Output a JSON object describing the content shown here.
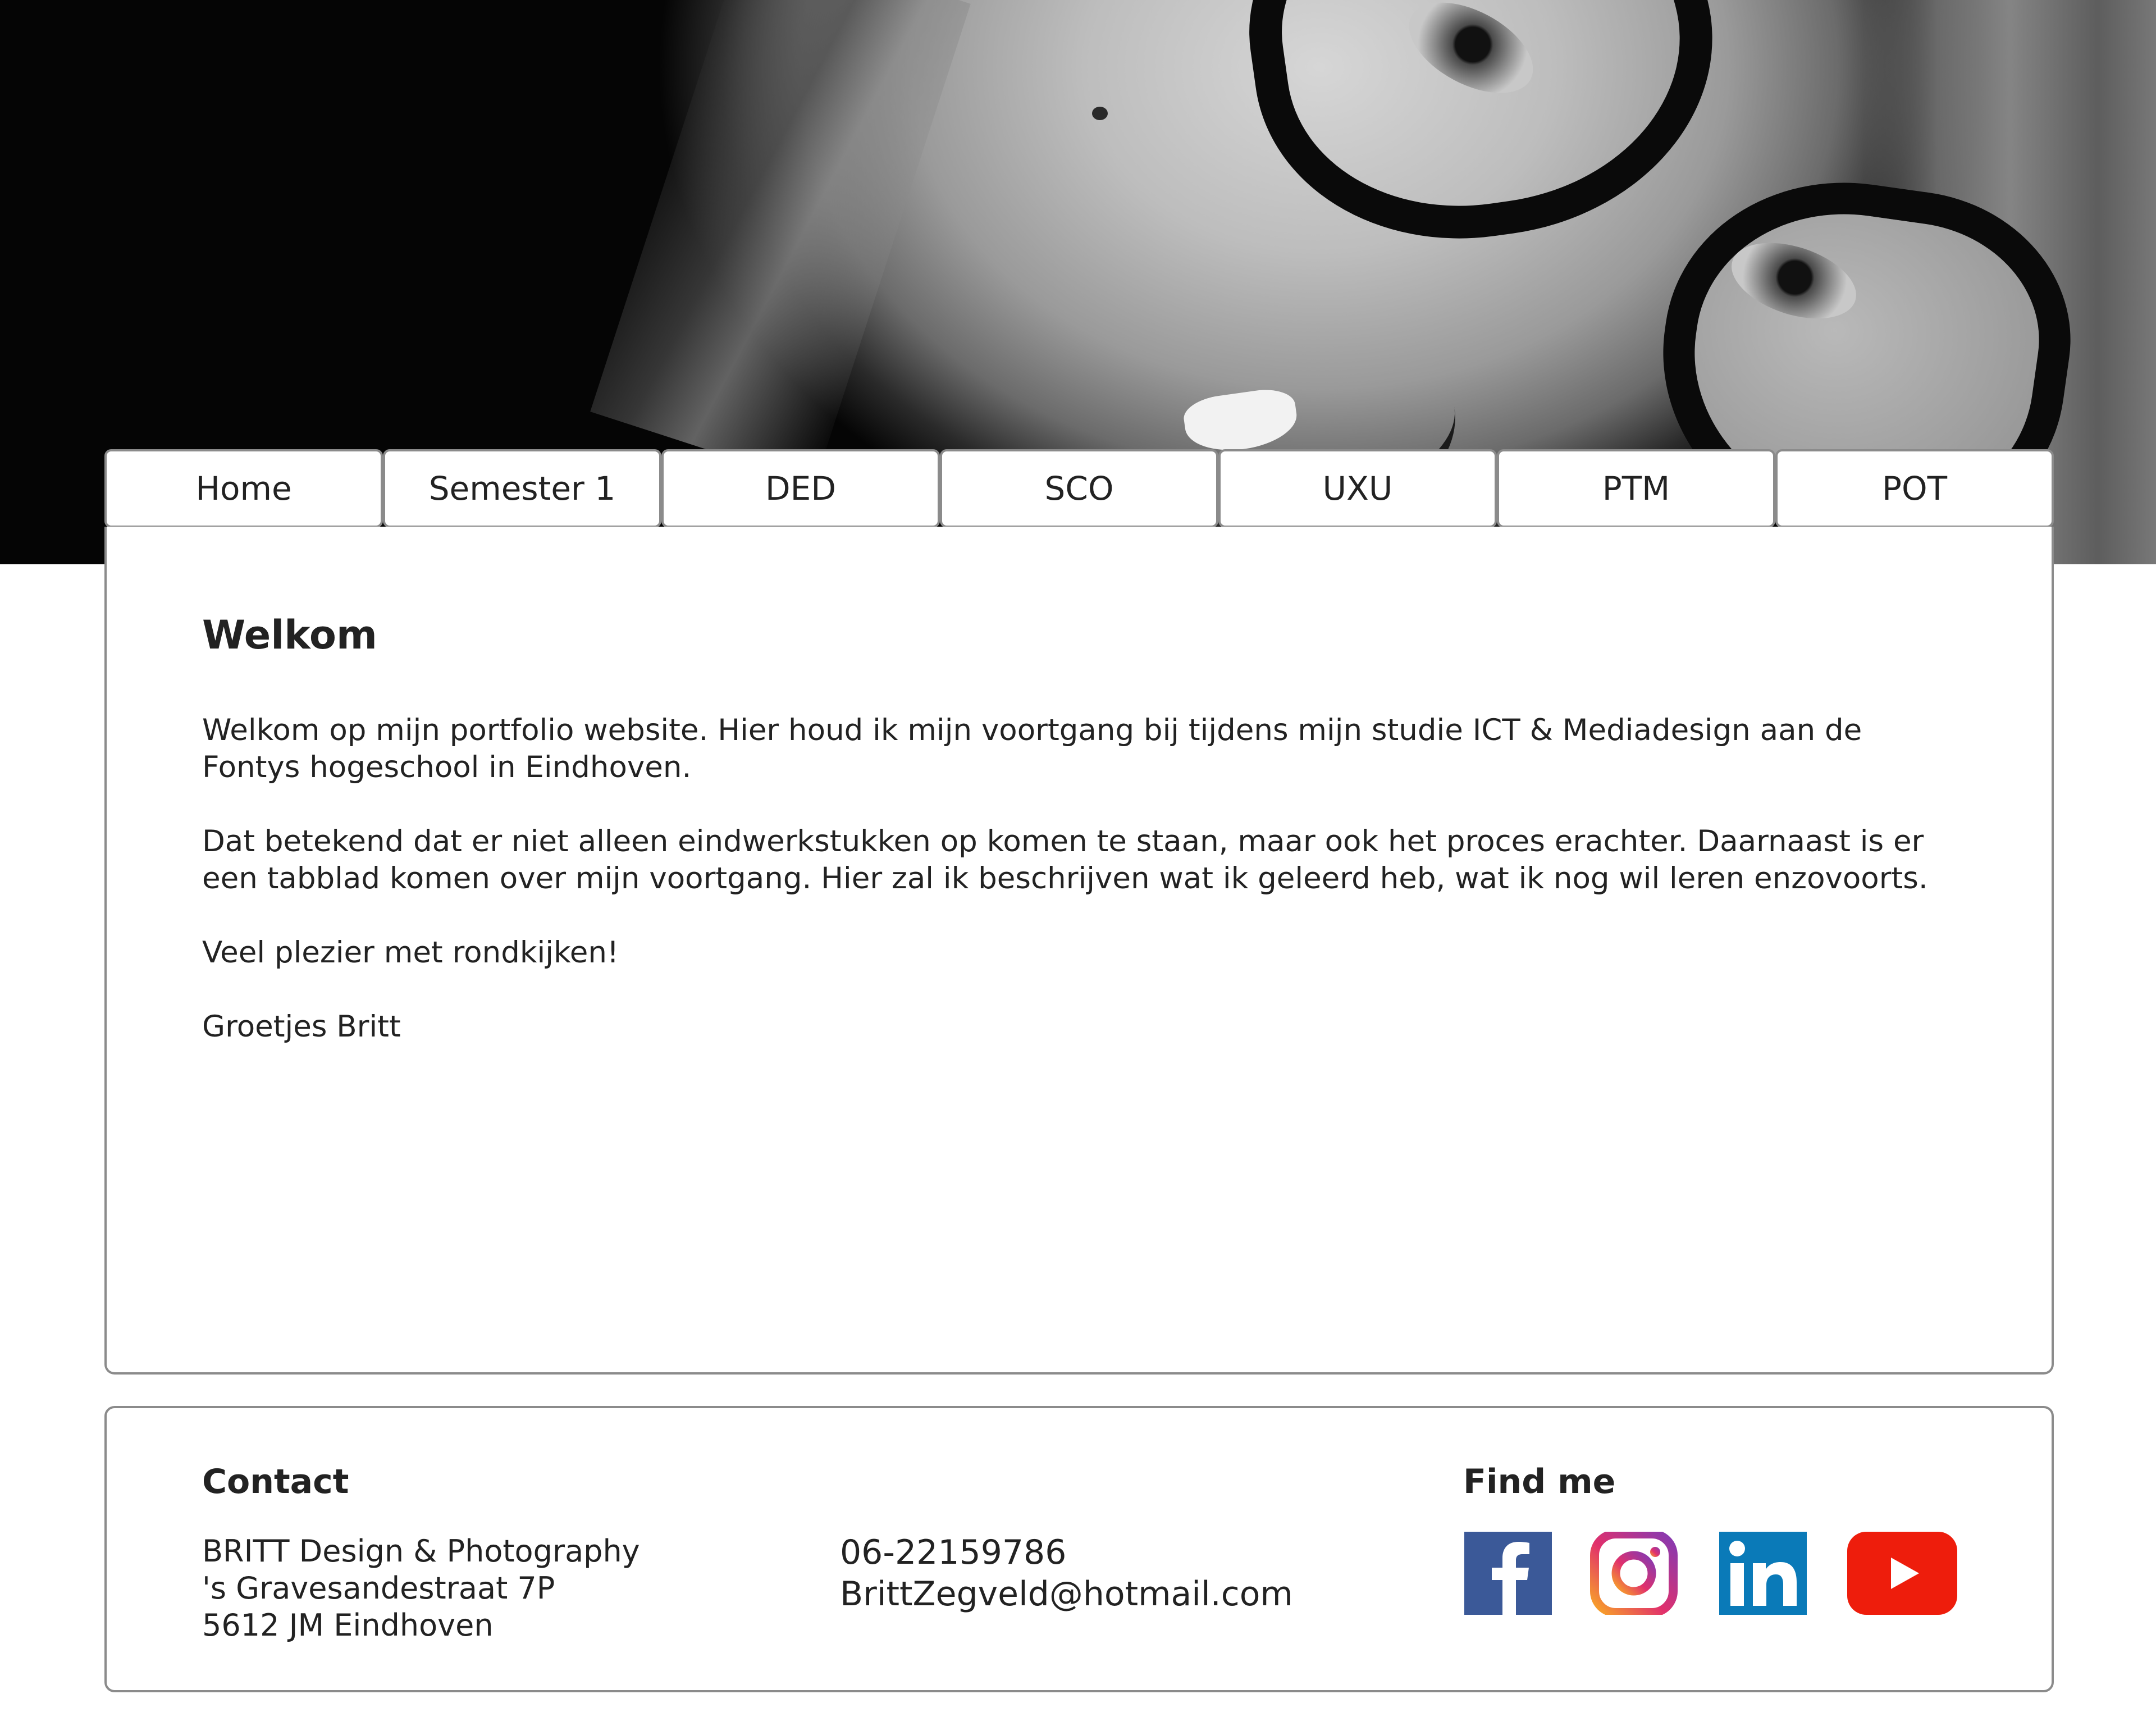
{
  "header": {
    "image_alt": "Black and white portrait with glasses"
  },
  "nav": {
    "tabs": [
      {
        "label": "Home"
      },
      {
        "label": "Semester 1"
      },
      {
        "label": "DED"
      },
      {
        "label": "SCO"
      },
      {
        "label": "UXU"
      },
      {
        "label": "PTM"
      },
      {
        "label": "POT"
      }
    ]
  },
  "main": {
    "title": "Welkom",
    "paragraphs": [
      "Welkom op mijn portfolio website. Hier houd ik mijn voortgang bij tijdens mijn studie ICT & Mediadesign aan de Fontys hogeschool in Eindhoven.",
      "Dat betekend dat er niet alleen eindwerkstukken op komen te staan, maar ook het proces erachter. Daarnaast is er een tabblad komen over mijn voortgang. Hier zal ik beschrijven wat ik geleerd heb, wat ik nog wil leren enzovoorts.",
      "Veel plezier met rondkijken!",
      "Groetjes Britt"
    ]
  },
  "footer": {
    "contact_title": "Contact",
    "address": {
      "line1": "BRITT Design & Photography",
      "line2": "'s Gravesandestraat 7P",
      "line3": "5612 JM Eindhoven"
    },
    "phone": "06-22159786",
    "email": "BrittZegveld@hotmail.com",
    "find_title": "Find me",
    "social": [
      {
        "icon": "facebook-icon",
        "color": "#3b5998"
      },
      {
        "icon": "instagram-icon",
        "color": "#c13584"
      },
      {
        "icon": "linkedin-icon",
        "color": "#0a7ab8"
      },
      {
        "icon": "youtube-icon",
        "color": "#ee1d0c"
      }
    ]
  }
}
